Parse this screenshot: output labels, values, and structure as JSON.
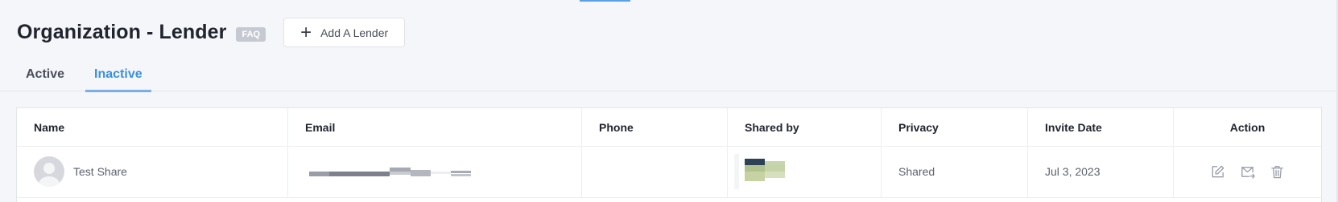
{
  "header": {
    "title": "Organization - Lender",
    "faq_label": "FAQ",
    "add_button_label": "Add A Lender"
  },
  "tabs": [
    {
      "label": "Active",
      "active": false
    },
    {
      "label": "Inactive",
      "active": true
    }
  ],
  "table": {
    "columns": [
      "Name",
      "Email",
      "Phone",
      "Shared by",
      "Privacy",
      "Invite Date",
      "Action"
    ],
    "rows": [
      {
        "name": "Test Share",
        "email": "",
        "phone": "",
        "shared_by": "",
        "privacy": "Shared",
        "invite_date": "Jul 3, 2023",
        "actions": [
          "edit-icon",
          "mail-icon",
          "trash-icon"
        ]
      }
    ]
  },
  "colors": {
    "accent": "#3b8fe0",
    "background": "#f5f6fa",
    "faq_badge": "#c6c9d2"
  }
}
